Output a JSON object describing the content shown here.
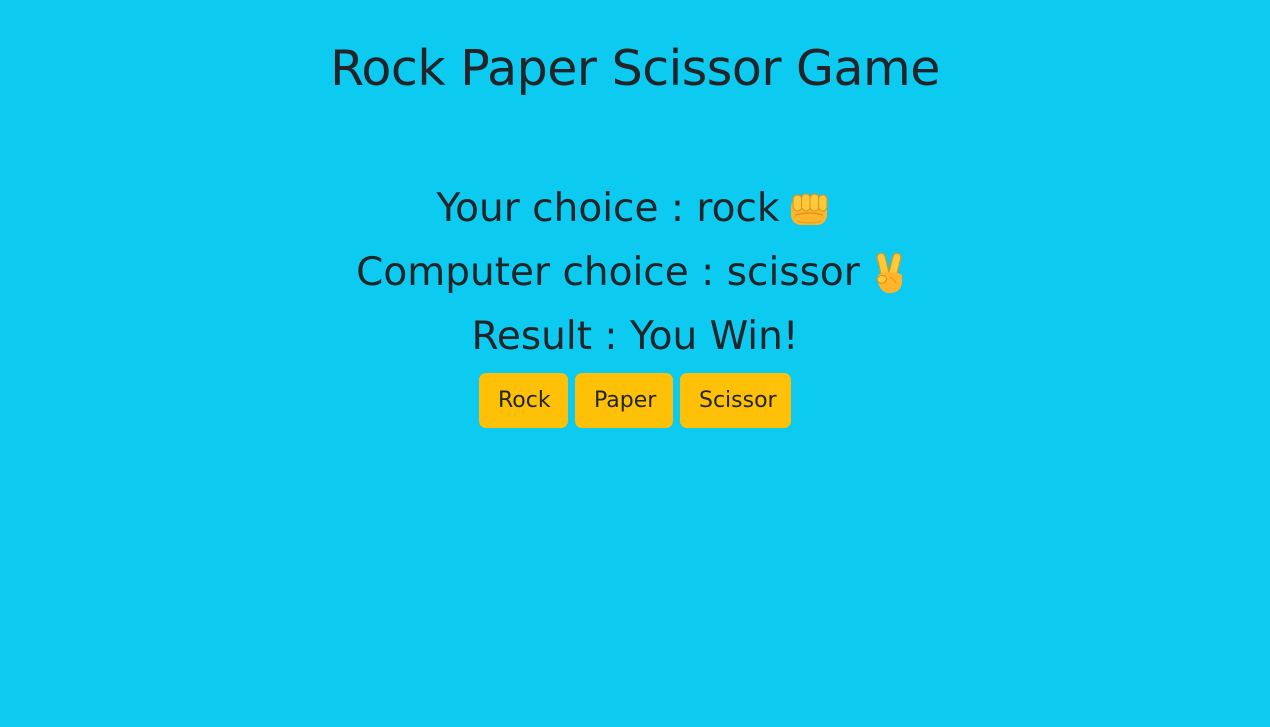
{
  "title": "Rock Paper Scissor Game",
  "your_choice": {
    "label": "Your choice",
    "separator": " : ",
    "value": "rock",
    "icon": "oncoming-fist-icon"
  },
  "computer_choice": {
    "label": "Computer choice",
    "separator": " : ",
    "value": "scissor",
    "icon": "victory-hand-icon"
  },
  "result": {
    "label": "Result",
    "separator": " : ",
    "value": "You Win!"
  },
  "buttons": {
    "rock": "Rock",
    "paper": "Paper",
    "scissor": "Scissor"
  },
  "colors": {
    "background": "#0dcaf0",
    "button": "#ffc107",
    "text": "#212529"
  }
}
